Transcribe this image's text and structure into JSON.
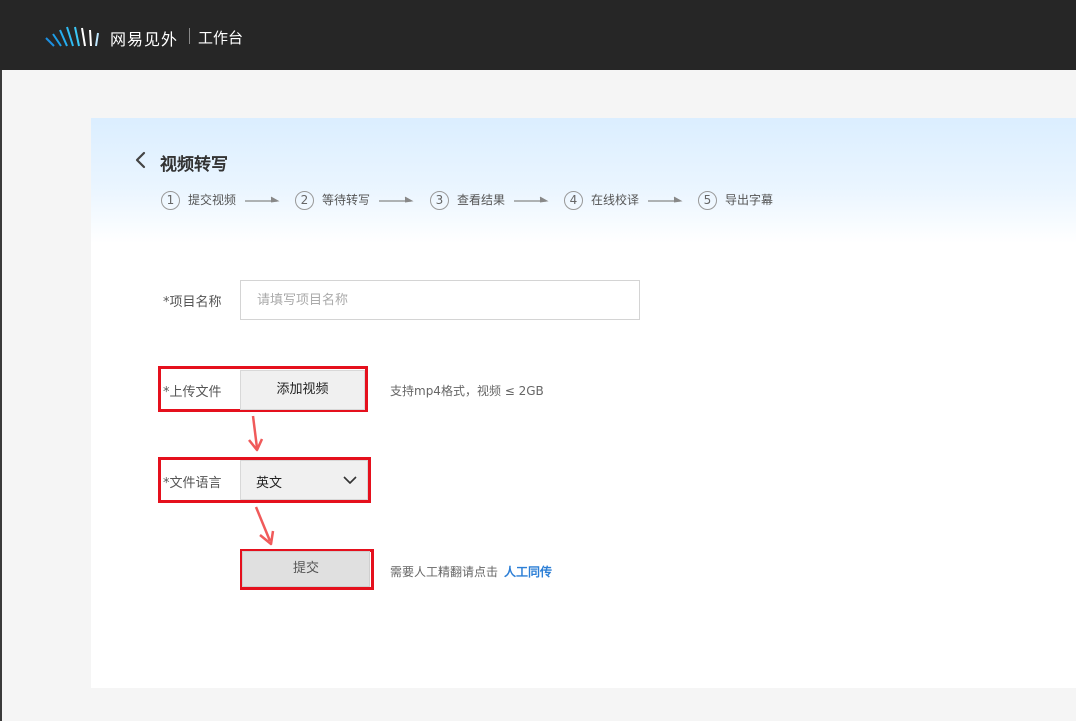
{
  "header": {
    "brand": "网易见外",
    "subtitle": "工作台"
  },
  "page": {
    "title": "视频转写"
  },
  "steps": [
    {
      "num": "1",
      "label": "提交视频"
    },
    {
      "num": "2",
      "label": "等待转写"
    },
    {
      "num": "3",
      "label": "查看结果"
    },
    {
      "num": "4",
      "label": "在线校译"
    },
    {
      "num": "5",
      "label": "导出字幕"
    }
  ],
  "form": {
    "project_name": {
      "label": "*项目名称",
      "placeholder": "请填写项目名称",
      "value": ""
    },
    "upload": {
      "label": "*上传文件",
      "button": "添加视频",
      "hint": "支持mp4格式，视频 ≤ 2GB"
    },
    "language": {
      "label": "*文件语言",
      "value": "英文"
    },
    "submit": {
      "button": "提交",
      "hint": "需要人工精翻请点击",
      "link": "人工同传"
    }
  },
  "colors": {
    "topbar": "#262626",
    "highlight": "#e5101d",
    "link": "#2d7fd6"
  },
  "icons": [
    "logo-mark-icon",
    "chevron-left-icon",
    "chevron-down-icon",
    "step-arrow-icon",
    "red-arrow-icon"
  ]
}
